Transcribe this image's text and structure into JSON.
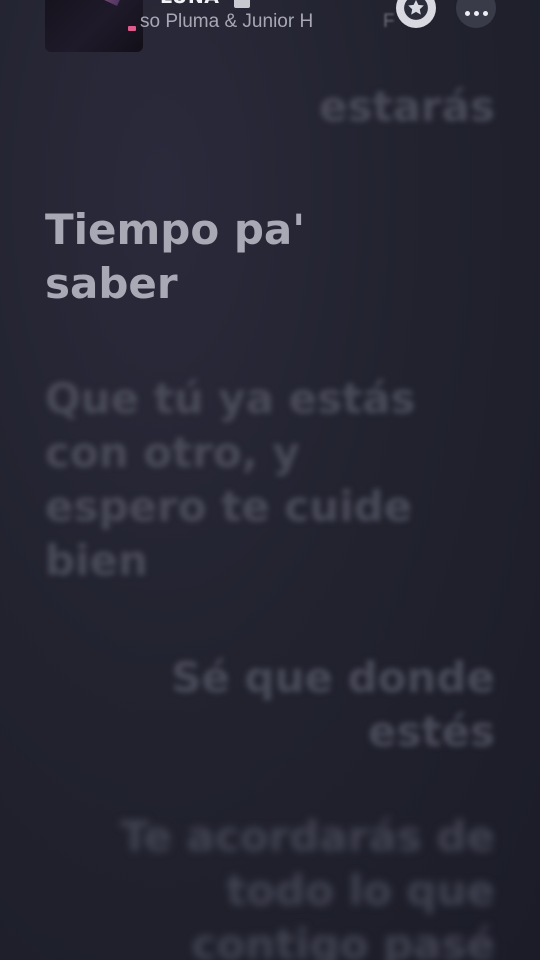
{
  "now_playing": {
    "title": "LUNA",
    "artist": "so Pluma & Junior H",
    "edge_text": "F",
    "explicit_icon": "explicit-badge-icon",
    "favorite_icon": "star-icon",
    "more_icon": "ellipsis-icon"
  },
  "lyrics": [
    {
      "text": "estarás",
      "state": "past",
      "align": "right"
    },
    {
      "text": "Tiempo pa' saber",
      "state": "current",
      "align": "left"
    },
    {
      "text": "Que tú ya estás con otro, y espero te cuide bien",
      "state": "upcoming",
      "align": "left"
    },
    {
      "text": "Sé que donde estés",
      "state": "upcoming",
      "align": "right"
    },
    {
      "text": "Te acordarás de todo lo que contigo pasé",
      "state": "upcoming",
      "align": "right"
    }
  ],
  "colors": {
    "background": "#1e1f2c",
    "active_lyric": "#a9a9b6",
    "inactive_lyric": "#4a4b59"
  }
}
